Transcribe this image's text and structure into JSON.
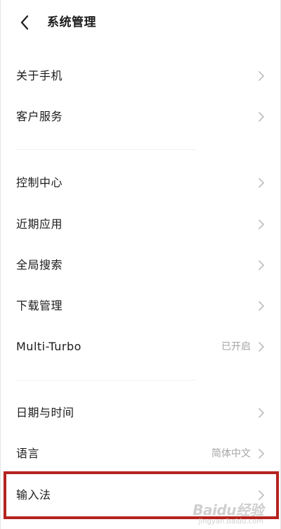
{
  "header": {
    "title": "系统管理"
  },
  "items": [
    {
      "label": "关于手机",
      "value": ""
    },
    {
      "label": "客户服务",
      "value": ""
    },
    {
      "label": "控制中心",
      "value": ""
    },
    {
      "label": "近期应用",
      "value": ""
    },
    {
      "label": "全局搜索",
      "value": ""
    },
    {
      "label": "下载管理",
      "value": ""
    },
    {
      "label": "Multi-Turbo",
      "value": "已开启"
    },
    {
      "label": "日期与时间",
      "value": ""
    },
    {
      "label": "语言",
      "value": "简体中文"
    },
    {
      "label": "输入法",
      "value": ""
    }
  ],
  "watermark": {
    "logo": "Baidu经验",
    "url": "jingyan.baidu.com"
  },
  "colors": {
    "highlight": "#b4231f",
    "secondary_text": "#a5a5a5",
    "chevron": "#bdbdbd"
  }
}
